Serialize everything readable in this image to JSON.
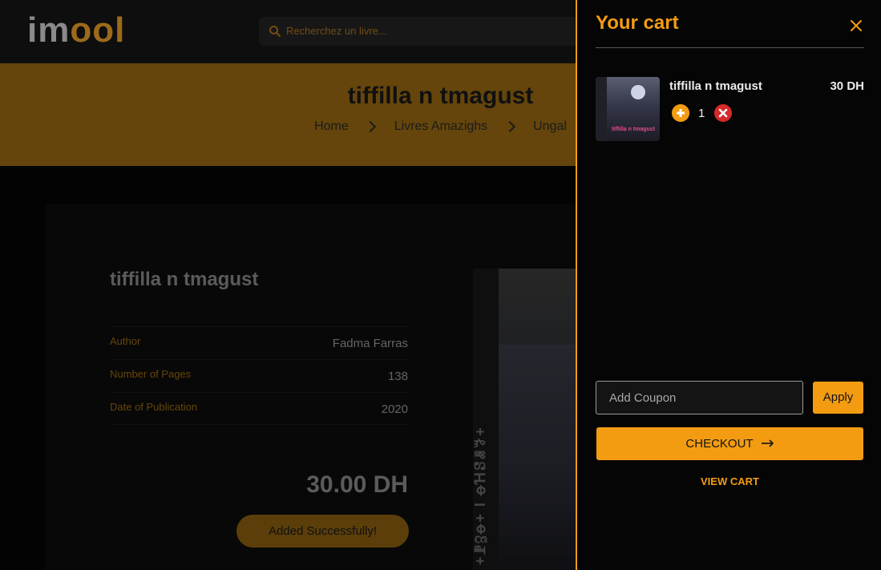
{
  "header": {
    "logo_part1": "im",
    "logo_part2": "ool",
    "search_placeholder": "Recherchez un livre..."
  },
  "banner": {
    "title": "tiffilla n tmagust",
    "breadcrumbs": [
      "Home",
      "Livres Amazighs",
      "Ungal"
    ]
  },
  "product": {
    "title": "tiffilla n tmagust",
    "specs": [
      {
        "label": "Author",
        "value": "Fadma Farras"
      },
      {
        "label": "Number of Pages",
        "value": "138"
      },
      {
        "label": "Date of Publication",
        "value": "2020"
      }
    ],
    "price": "30.00 DH",
    "added_label": "Added Successfully!",
    "cover_spine_text": "+ꗘℨꝋ+ I ꝋꞪꗟꗡꗌ+"
  },
  "cart": {
    "title": "Your cart",
    "items": [
      {
        "name": "tiffilla n tmagust",
        "price": "30 DH",
        "quantity": "1",
        "thumb_text": "tiffilla n tmagust"
      }
    ],
    "coupon_placeholder": "Add Coupon",
    "apply_label": "Apply",
    "checkout_label": "CHECKOUT",
    "view_cart_label": "VIEW CART"
  },
  "colors": {
    "accent": "#f39c12",
    "banner": "#9b6a12",
    "remove": "#d62929"
  }
}
